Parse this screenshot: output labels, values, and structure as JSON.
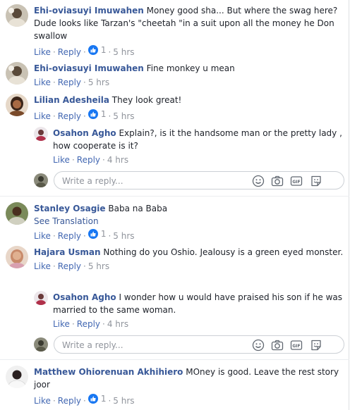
{
  "comments": [
    {
      "author": "Ehi-oviasuyi Imuwahen",
      "text": "Money good sha... But where the swag here? Dude looks like Tarzan's \"cheetah \"in a suit upon all the money he Don swallow",
      "like_label": "Like",
      "reply_label": "Reply",
      "likes": "1",
      "time": "5 hrs"
    },
    {
      "author": "Ehi-oviasuyi Imuwahen",
      "text": "Fine monkey u mean",
      "like_label": "Like",
      "reply_label": "Reply",
      "time": "5 hrs"
    },
    {
      "author": "Lilian Adesheila",
      "text": "They look great!",
      "like_label": "Like",
      "reply_label": "Reply",
      "likes": "1",
      "time": "5 hrs"
    },
    {
      "author": "Stanley Osagie",
      "text": "Baba na Baba",
      "see_translation": "See Translation",
      "like_label": "Like",
      "reply_label": "Reply",
      "likes": "1",
      "time": "5 hrs"
    },
    {
      "author": "Hajara Usman",
      "text": "Nothing do you Oshio. Jealousy is a green eyed monster.",
      "like_label": "Like",
      "reply_label": "Reply",
      "time": "5 hrs"
    },
    {
      "author": "Matthew Ohiorenuan Akhihiero",
      "text": "MOney is good. Leave the rest story joor",
      "like_label": "Like",
      "reply_label": "Reply",
      "likes": "1",
      "time": "5 hrs"
    }
  ],
  "replies": [
    {
      "author": "Osahon Agho",
      "text": "Explain?, is it the handsome man or the pretty lady , how cooperate is it?",
      "like_label": "Like",
      "reply_label": "Reply",
      "time": "4 hrs"
    },
    {
      "author": "Osahon Agho",
      "text": "I wonder how u would have praised his son if he was married to the same woman.",
      "like_label": "Like",
      "reply_label": "Reply",
      "time": "4 hrs"
    }
  ],
  "reply_box": {
    "placeholder": "Write a reply..."
  },
  "icons": [
    "smiley-icon",
    "camera-icon",
    "gif-icon",
    "sticker-icon",
    "like-reaction-icon"
  ],
  "colors": {
    "link": "#385898",
    "action": "#4267b2",
    "meta": "#90949c",
    "like": "#1877f2"
  }
}
